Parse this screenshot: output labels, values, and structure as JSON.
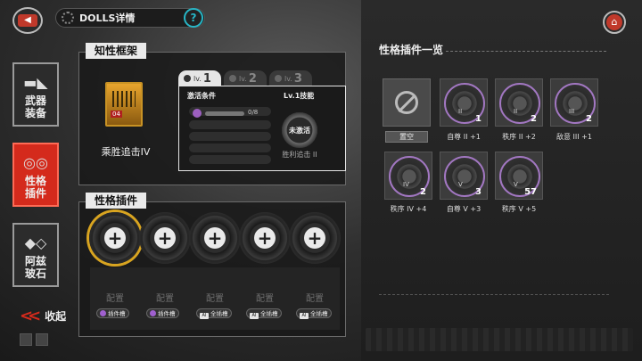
{
  "header": {
    "title": "DOLLS详情",
    "help_symbol": "?",
    "back_symbol": "◀",
    "home_symbol": "⌂"
  },
  "sidebar": {
    "items": [
      {
        "label_line1": "武器",
        "label_line2": "装备",
        "icon": "gun-icon",
        "active": false
      },
      {
        "label_line1": "性格",
        "label_line2": "插件",
        "icon": "gear-pair-icon",
        "active": true
      },
      {
        "label_line1": "阿兹",
        "label_line2": "玻石",
        "icon": "crystal-icon",
        "active": false
      }
    ],
    "collapse_label": "收起",
    "collapse_symbol": "«"
  },
  "intelligence_frame": {
    "label": "知性框架",
    "chip_number": "04",
    "chip_name": "乘胜追击IV",
    "levels": [
      {
        "prefix": "lv.",
        "num": "1",
        "active": true
      },
      {
        "prefix": "lv.",
        "num": "2",
        "active": false
      },
      {
        "prefix": "lv.",
        "num": "3",
        "active": false
      }
    ],
    "activation_title": "激活条件",
    "activation_progress": "0/8",
    "activation_fraction": 0,
    "skill_title": "Lv.1技能",
    "skill_badge": "未激活",
    "skill_name": "胜利追击 II"
  },
  "personality_plugins": {
    "label": "性格插件",
    "slots": [
      {
        "plus": "+",
        "status": "配置",
        "tag": "插件槽",
        "tag_type": "purple",
        "selected": true
      },
      {
        "plus": "+",
        "status": "配置",
        "tag": "插件槽",
        "tag_type": "purple",
        "selected": false
      },
      {
        "plus": "+",
        "status": "配置",
        "tag": "全插槽",
        "tag_type": "ai",
        "selected": false
      },
      {
        "plus": "+",
        "status": "配置",
        "tag": "全插槽",
        "tag_type": "ai",
        "selected": false
      },
      {
        "plus": "+",
        "status": "配置",
        "tag": "全插槽",
        "tag_type": "ai",
        "selected": false
      }
    ],
    "ai_mark": "AI"
  },
  "plugin_list": {
    "title": "性格插件一览",
    "empty_label": "置空",
    "items": [
      {
        "roman": "II",
        "count": "1",
        "label": "自尊 II +1"
      },
      {
        "roman": "II",
        "count": "2",
        "label": "秩序 II +2"
      },
      {
        "roman": "III",
        "count": "2",
        "label": "敌意 III +1"
      },
      {
        "roman": "IV",
        "count": "2",
        "label": "秩序 IV +4"
      },
      {
        "roman": "V",
        "count": "3",
        "label": "自尊 V +3"
      },
      {
        "roman": "V",
        "count": "57",
        "label": "秩序 V +5"
      }
    ]
  },
  "colors": {
    "accent_red": "#d42a1c",
    "selected_gold": "#d8a420",
    "plugin_purple": "#a277c2",
    "help_cyan": "#27b6c6"
  }
}
